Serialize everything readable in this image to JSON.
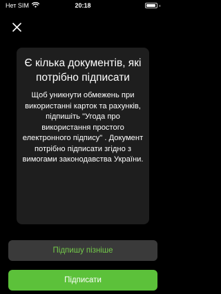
{
  "status_bar": {
    "carrier": "Нет SIM",
    "time": "20:18"
  },
  "icons": {
    "wifi": "wifi-icon",
    "battery": "battery-icon",
    "close": "close-icon"
  },
  "dialog": {
    "title": "Є кілька документів, які потрібно підписати",
    "body": "Щоб уникнути обмежень при використанні карток та рахунків, підпишіть \"Угода про використання простого електронного підпису\" . Документ потрібно підписати згідно з вимогами законодавства України."
  },
  "buttons": {
    "later_label": "Підпишу пізніше",
    "sign_label": "Підписати"
  },
  "colors": {
    "background": "#000000",
    "card": "#1e1e1e",
    "accent_green": "#5cc13a",
    "secondary_button": "#3a3a3a",
    "secondary_text": "#74c94a"
  }
}
